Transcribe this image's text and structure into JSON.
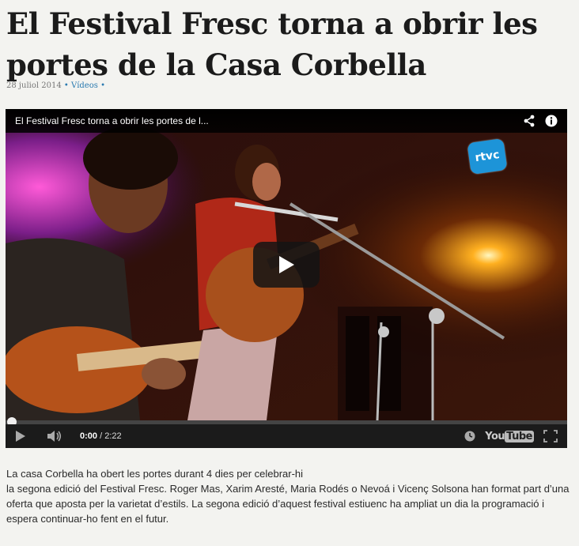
{
  "article": {
    "title": "El Festival Fresc torna a obrir les portes de la Casa Corbella",
    "date": "28 juliol 2014",
    "separator": "•",
    "category": "Vídeos"
  },
  "player": {
    "video_title": "El Festival Fresc torna a obrir les portes de l...",
    "channel_logo": "rtvc",
    "current_time": "0:00",
    "time_separator": "/",
    "duration": "2:22",
    "progress": 0,
    "youtube_label_you": "You",
    "youtube_label_tube": "Tube",
    "icons": {
      "share": "share-icon",
      "info": "info-icon",
      "play": "play-icon",
      "volume": "volume-icon",
      "watch_later": "clock-icon",
      "fullscreen": "fullscreen-icon"
    }
  },
  "body": {
    "line1": "La casa Corbella ha obert les portes durant 4 dies per celebrar-hi",
    "paragraph": "la segona edició del Festival Fresc. Roger Mas, Xarim Aresté, Maria Rodés o Nevoá i Vicenç Solsona han format part d’una oferta que aposta per la varietat d’estils. La segona edició d’aquest festival estiuenc ha ampliat un dia la programació i espera continuar-ho fent en el futur."
  }
}
